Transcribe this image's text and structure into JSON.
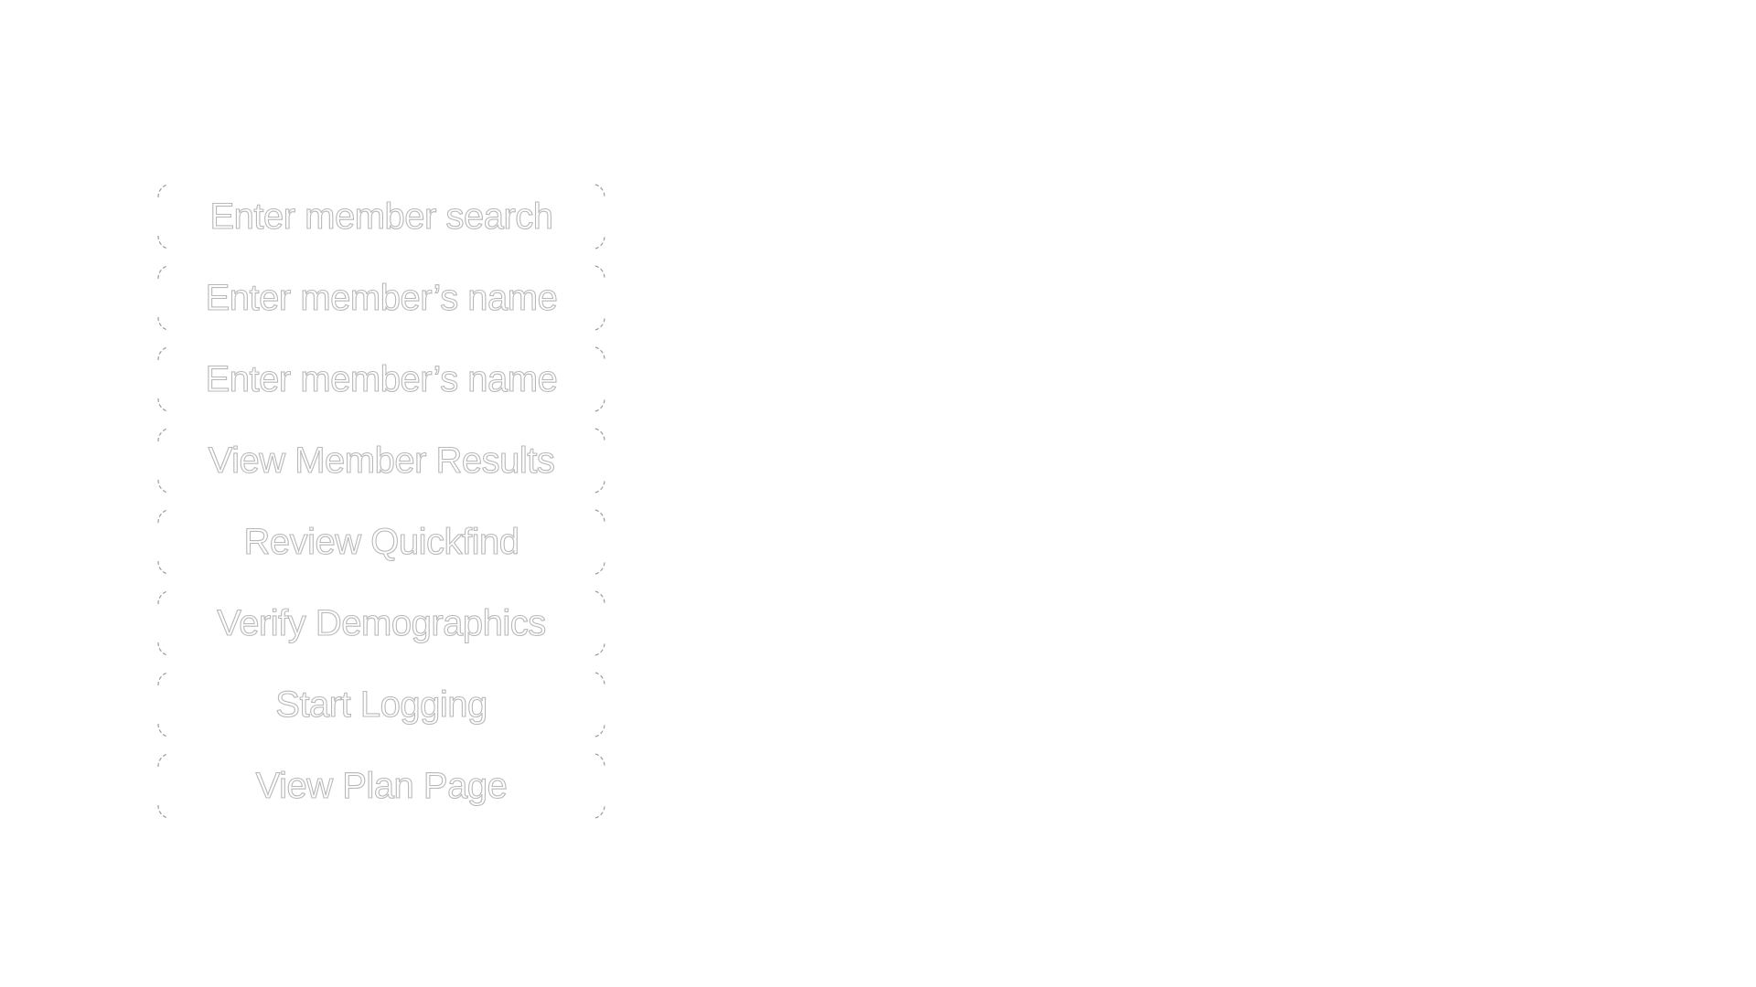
{
  "diagram": {
    "steps": [
      {
        "label": "Enter member search"
      },
      {
        "label": "Enter member’s name"
      },
      {
        "label": "Enter member’s name"
      },
      {
        "label": "View Member Results"
      },
      {
        "label": "Review Quickfind"
      },
      {
        "label": "Verify Demographics"
      },
      {
        "label": "Start Logging"
      },
      {
        "label": "View Plan Page"
      }
    ]
  },
  "colors": {
    "background": "#ffffff",
    "text_outline": "#b8b8b8",
    "frame_stroke": "#9a9a9a"
  }
}
